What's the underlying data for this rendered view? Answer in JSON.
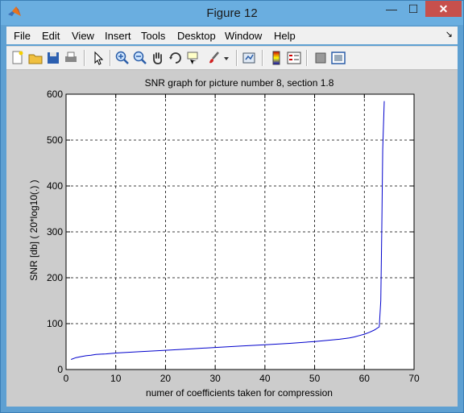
{
  "window": {
    "title": "Figure 12",
    "minimize": "—",
    "maximize": "☐",
    "close": "✕"
  },
  "menu": [
    "File",
    "Edit",
    "View",
    "Insert",
    "Tools",
    "Desktop",
    "Window",
    "Help"
  ],
  "menu_arrow": "↘",
  "toolbar": [
    "new-figure-icon",
    "open-file-icon",
    "save-icon",
    "print-icon",
    "edit-plot-icon",
    "zoom-in-icon",
    "zoom-out-icon",
    "pan-icon",
    "rotate-3d-icon",
    "data-cursor-icon",
    "brush-icon",
    "brush-dropdown-icon",
    "link-plot-icon",
    "insert-colorbar-icon",
    "insert-legend-icon",
    "hide-plot-tools-icon",
    "show-plot-tools-icon"
  ],
  "chart_data": {
    "type": "line",
    "title": "SNR graph for picture number 8, section 1.8",
    "xlabel": "numer of coefficients taken for compression",
    "ylabel": "SNR [db] ( 20*log10(.) )",
    "xlim": [
      0,
      70
    ],
    "ylim": [
      0,
      600
    ],
    "xticks": [
      0,
      10,
      20,
      30,
      40,
      50,
      60,
      70
    ],
    "yticks": [
      0,
      100,
      200,
      300,
      400,
      500,
      600
    ],
    "grid": true,
    "color": "#0000cc",
    "x": [
      1,
      2,
      3,
      4,
      5,
      6,
      8,
      10,
      15,
      20,
      25,
      30,
      35,
      40,
      45,
      50,
      55,
      57,
      58,
      59,
      60,
      61,
      62,
      63,
      63.3,
      63.5,
      63.7,
      64
    ],
    "y": [
      22,
      26,
      28,
      30,
      31,
      33,
      34,
      36,
      39,
      42,
      45,
      48,
      51,
      54,
      57,
      61,
      66,
      69,
      71,
      74,
      77,
      81,
      86,
      93,
      150,
      300,
      480,
      585
    ]
  }
}
